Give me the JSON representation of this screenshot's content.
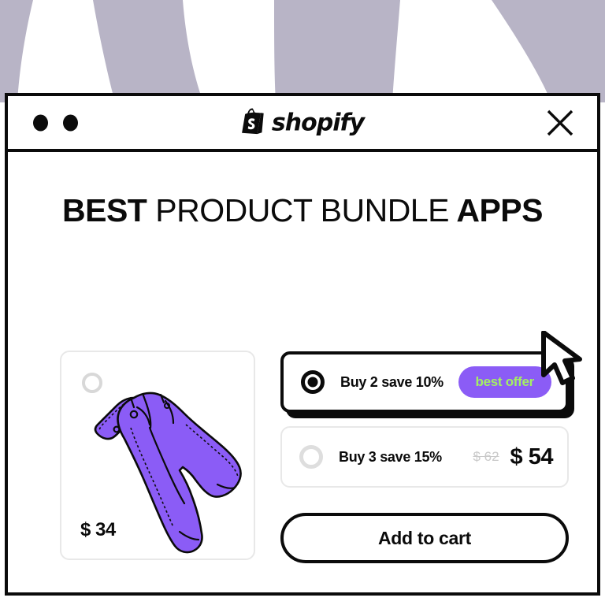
{
  "window": {
    "titlebar": {
      "dots": [
        "dot-1",
        "dot-2"
      ],
      "brand_name": "shopify",
      "brand_icon": "shopify-bag-icon",
      "close_icon": "close-icon"
    }
  },
  "headline": {
    "part1": "BEST",
    "part2": "PRODUCT BUNDLE",
    "part3": "APPS"
  },
  "product": {
    "price": "$ 34",
    "image_alt": "purple-jeans-illustration",
    "selected": false
  },
  "offers": [
    {
      "id": "buy-2",
      "label": "Buy 2 save 10%",
      "selected": true,
      "badge": "best offer",
      "price_old": "",
      "price_new": ""
    },
    {
      "id": "buy-3",
      "label": "Buy 3 save 15%",
      "selected": false,
      "badge": "",
      "price_old": "$ 62",
      "price_new": "$ 54"
    }
  ],
  "cta": {
    "add_to_cart_label": "Add to cart"
  },
  "colors": {
    "accent_purple": "#8b5cf6",
    "badge_text_green": "#a4ef63",
    "ink": "#0b0b0b",
    "backdrop_stripe": "#b8b4c6",
    "border_light": "#e8e8e8"
  },
  "cursor": {
    "icon": "arrow-pointer-icon"
  }
}
